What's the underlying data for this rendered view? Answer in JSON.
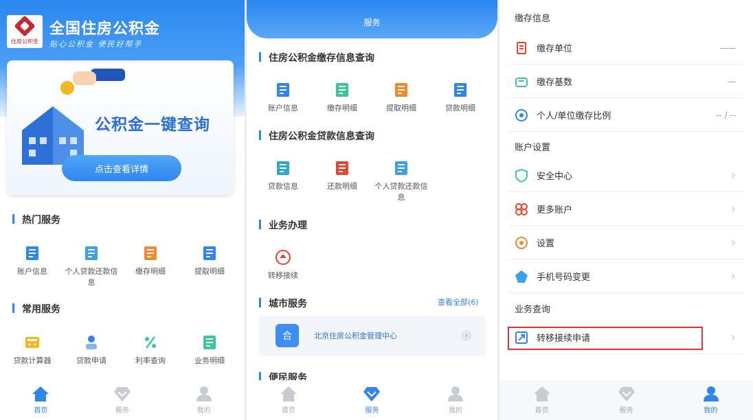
{
  "panel1": {
    "app_title": "全国住房公积金",
    "app_subtitle": "贴心公积金   便民好帮手",
    "logo_text": "住房公积金",
    "banner_title": "公积金一键查询",
    "banner_button": "点击查看详情",
    "hot_title": "热门服务",
    "hot_items": [
      {
        "label": "账户信息",
        "icon": "id-card-icon",
        "color": "#2f86ef"
      },
      {
        "label": "个人贷款还款信息",
        "icon": "card-icon",
        "color": "#3da0e8"
      },
      {
        "label": "缴存明细",
        "icon": "doc-orange-icon",
        "color": "#f08a2d"
      },
      {
        "label": "提取明细",
        "icon": "doc-blue-icon",
        "color": "#2f86ef"
      }
    ],
    "common_title": "常用服务",
    "common_items": [
      {
        "label": "贷款计算器",
        "icon": "calculator-icon",
        "color": "#f3b723"
      },
      {
        "label": "贷款申请",
        "icon": "person-icon",
        "color": "#2f86ef"
      },
      {
        "label": "利率查询",
        "icon": "percent-icon",
        "color": "#3fc59d"
      },
      {
        "label": "业务明细",
        "icon": "list-icon",
        "color": "#3fc59d"
      }
    ]
  },
  "panel2": {
    "header_title": "服务",
    "sec1_title": "住房公积金缴存信息查询",
    "sec1_items": [
      {
        "label": "账户信息",
        "icon": "id-card-icon",
        "color": "#2f86ef"
      },
      {
        "label": "缴存明细",
        "icon": "list-icon",
        "color": "#3fc59d"
      },
      {
        "label": "提取明细",
        "icon": "doc-orange-icon",
        "color": "#f08a2d"
      },
      {
        "label": "贷款明细",
        "icon": "doc-blue-icon",
        "color": "#2f86ef"
      }
    ],
    "sec2_title": "住房公积金贷款信息查询",
    "sec2_items": [
      {
        "label": "贷款信息",
        "icon": "loan-icon",
        "color": "#2fa9c9"
      },
      {
        "label": "还款明细",
        "icon": "bill-icon",
        "color": "#e8452f"
      },
      {
        "label": "个人贷款还款信息",
        "icon": "card-icon",
        "color": "#3da0e8"
      }
    ],
    "sec3_title": "业务办理",
    "sec3_items": [
      {
        "label": "转移接续",
        "icon": "transfer-icon",
        "color": "#e8452f"
      }
    ],
    "sec4_title": "城市服务",
    "see_all": "查看全部(6)",
    "city_card_text": "北京住房公积金管理中心",
    "city_icon_glyph": "合",
    "sec5_title": "便民服务"
  },
  "panel3": {
    "group1_title": "缴存信息",
    "group1_rows": [
      {
        "label": "缴存单位",
        "value": "——",
        "icon": "building-icon",
        "color": "#e8452f"
      },
      {
        "label": "缴存基数",
        "value": "—",
        "icon": "coin-icon",
        "color": "#3fc59d"
      },
      {
        "label": "个人/单位缴存比例",
        "value": "-- / --",
        "icon": "ratio-icon",
        "color": "#2f86ef"
      }
    ],
    "group2_title": "账户设置",
    "group2_rows": [
      {
        "label": "安全中心",
        "icon": "shield-icon",
        "color": "#3fc59d"
      },
      {
        "label": "更多账户",
        "icon": "accounts-icon",
        "color": "#e8452f"
      },
      {
        "label": "设置",
        "icon": "settings-icon",
        "color": "#f08a2d"
      },
      {
        "label": "手机号码变更",
        "icon": "phone-icon",
        "color": "#3da0e8"
      }
    ],
    "group3_title": "业务查询",
    "group3_rows": [
      {
        "label": "转移接续申请",
        "icon": "transfer-query-icon",
        "color": "#2f86ef"
      }
    ]
  },
  "tabs": [
    {
      "label": "首页",
      "icon": "home-icon"
    },
    {
      "label": "服务",
      "icon": "diamond-icon"
    },
    {
      "label": "我的",
      "icon": "user-icon"
    }
  ],
  "accent": "#2f86ef",
  "highlight_color": "#e53333"
}
